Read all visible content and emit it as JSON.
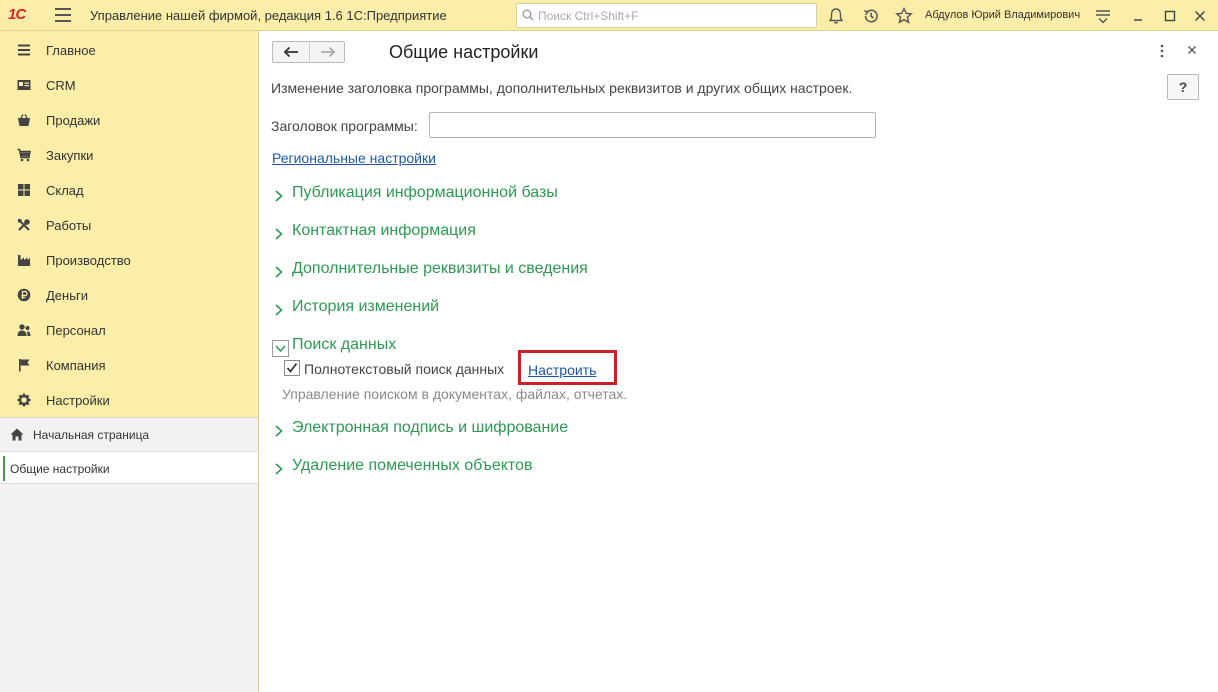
{
  "topbar": {
    "logo": "1С",
    "title": "Управление нашей фирмой, редакция 1.6 1С:Предприятие",
    "search_placeholder": "Поиск Ctrl+Shift+F",
    "username": "Абдулов Юрий Владимирович",
    "icons": [
      "bell-icon",
      "history-icon",
      "star-icon",
      "settings-menu-icon",
      "minimize-icon",
      "maximize-icon",
      "close-icon"
    ]
  },
  "sidebar": {
    "items": [
      {
        "label": "Главное",
        "icon": "menu-lines-icon"
      },
      {
        "label": "CRM",
        "icon": "contact-card-icon"
      },
      {
        "label": "Продажи",
        "icon": "basket-icon"
      },
      {
        "label": "Закупки",
        "icon": "cart-icon"
      },
      {
        "label": "Склад",
        "icon": "warehouse-grid-icon"
      },
      {
        "label": "Работы",
        "icon": "tools-icon"
      },
      {
        "label": "Производство",
        "icon": "factory-icon"
      },
      {
        "label": "Деньги",
        "icon": "ruble-coin-icon"
      },
      {
        "label": "Персонал",
        "icon": "people-icon"
      },
      {
        "label": "Компания",
        "icon": "flag-icon"
      },
      {
        "label": "Настройки",
        "icon": "gear-icon"
      }
    ],
    "open_windows": [
      {
        "label": "Начальная страница",
        "icon": "home-icon"
      },
      {
        "label": "Общие настройки"
      }
    ]
  },
  "main": {
    "title": "Общие настройки",
    "help_label": "?",
    "description": "Изменение заголовка программы, дополнительных реквизитов и других общих настроек.",
    "program_title_label": "Заголовок программы:",
    "program_title_value": "",
    "regional_link": "Региональные настройки",
    "sections": [
      "Публикация информационной базы",
      "Контактная информация",
      "Дополнительные реквизиты и сведения",
      "История изменений",
      "Поиск данных",
      "Электронная подпись и шифрование",
      "Удаление помеченных объектов"
    ],
    "fulltext_search_label": "Полнотекстовый поиск данных",
    "fulltext_search_checked": true,
    "configure_link": "Настроить",
    "search_hint": "Управление поиском в документах, файлах, отчетах.",
    "highlight_color": "#cc1f28",
    "section_color": "#2c9a52",
    "link_color": "#1d57a8"
  }
}
